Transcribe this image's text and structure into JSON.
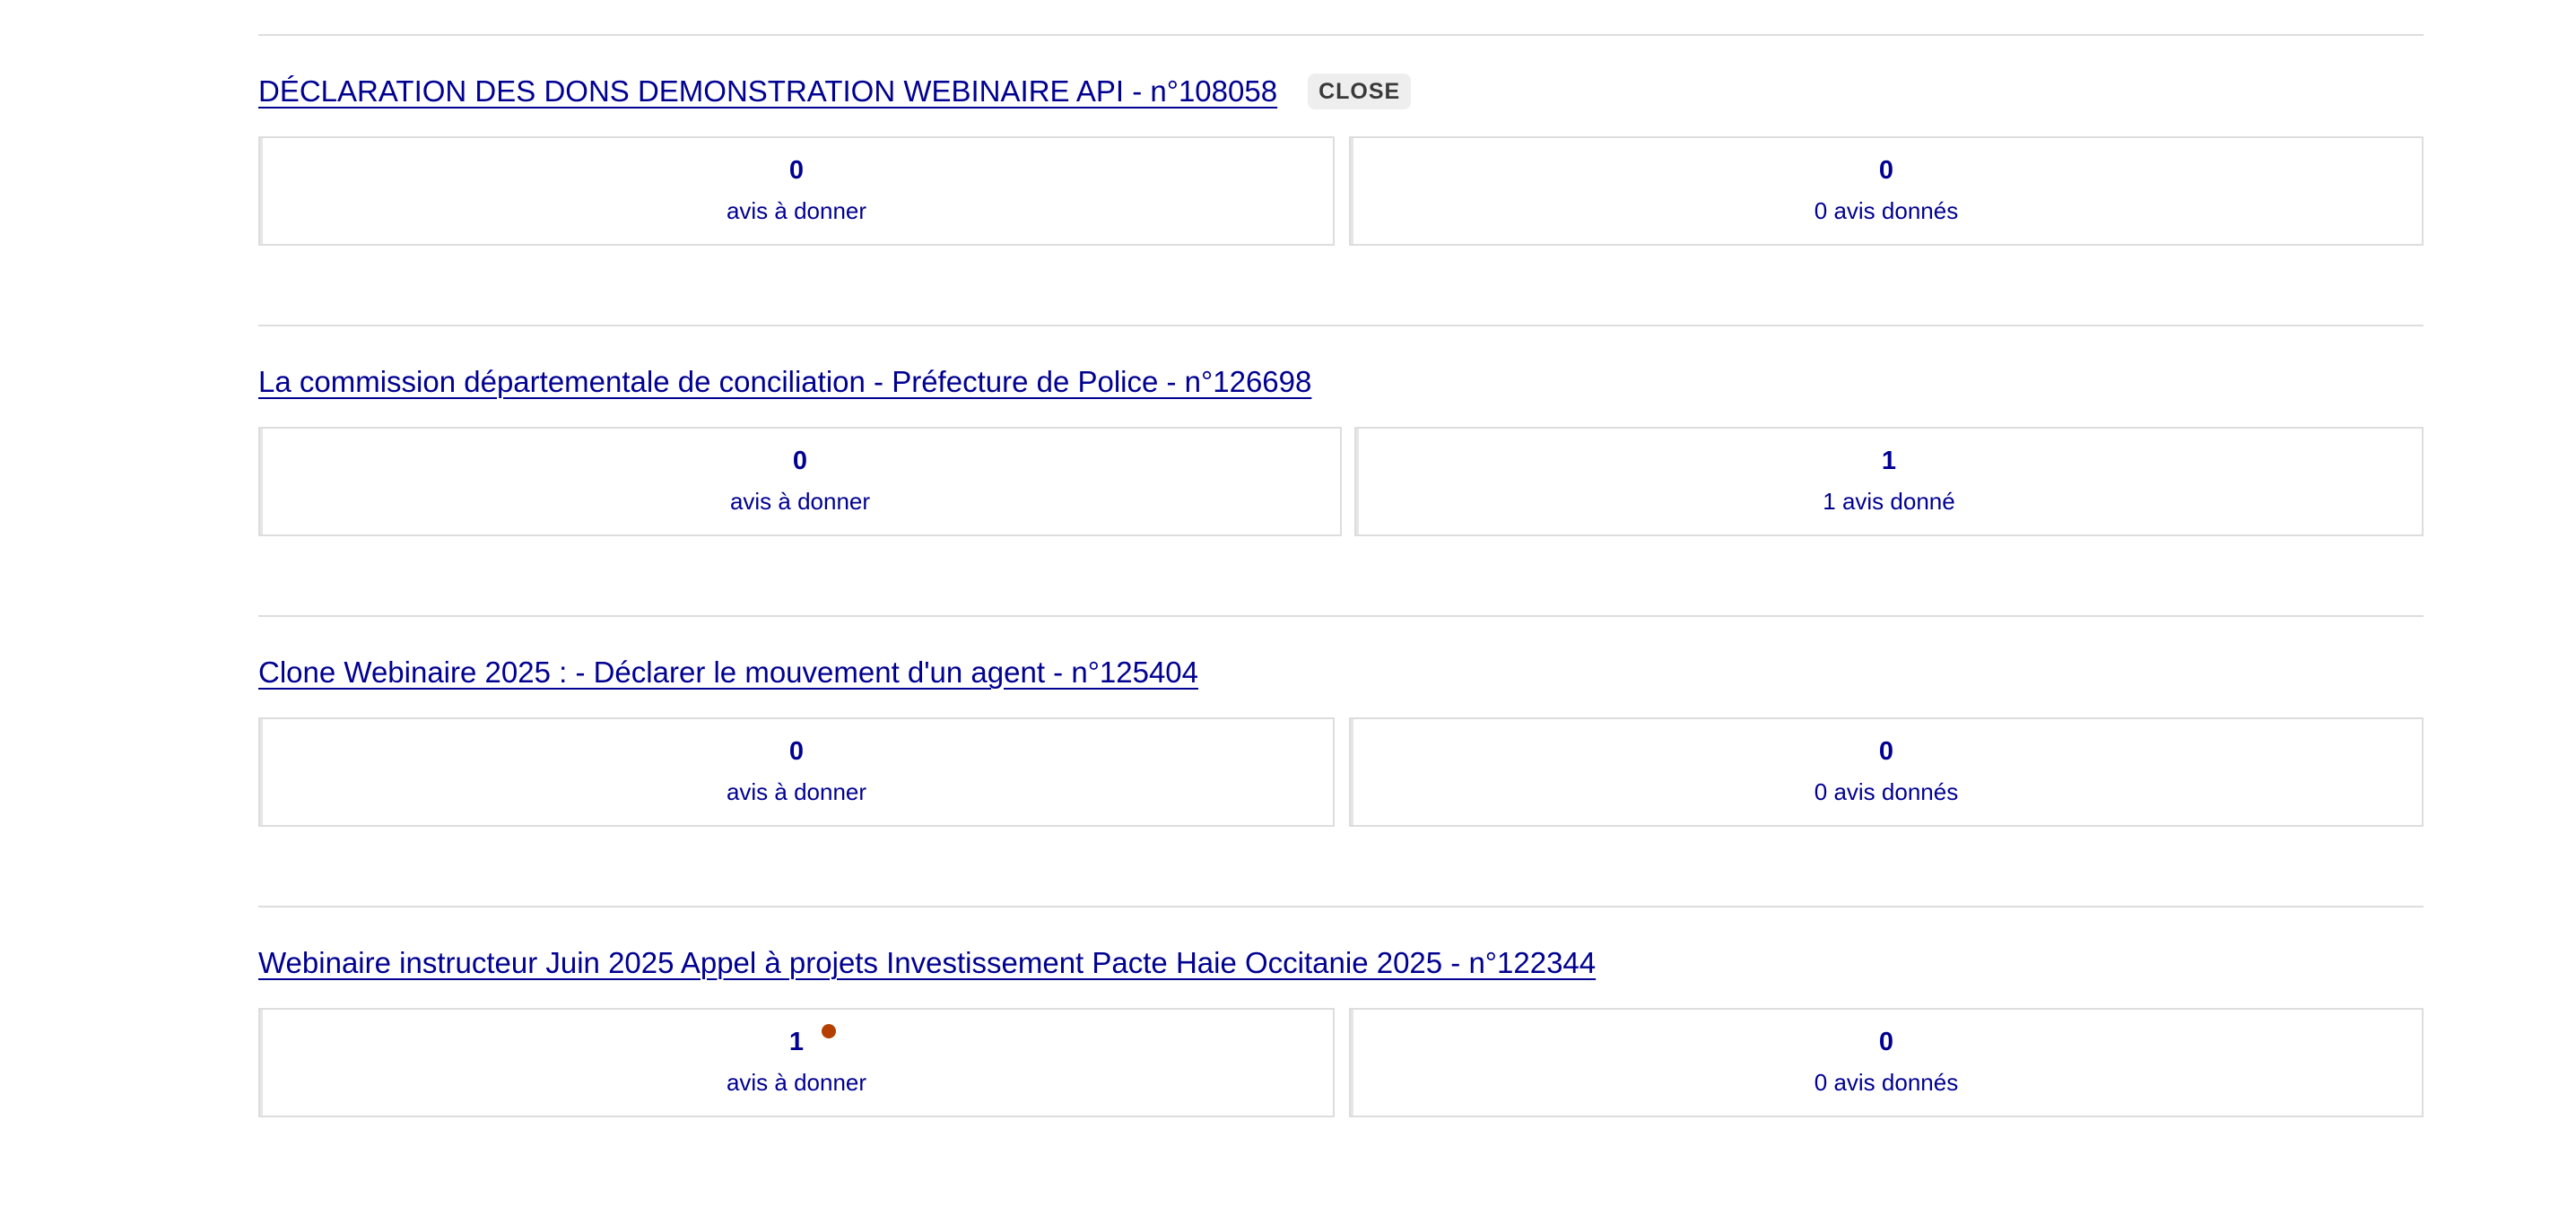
{
  "accent_color": "#000091",
  "notification_color": "#b34000",
  "procedures": [
    {
      "title": "DÉCLARATION DES DONS DEMONSTRATION WEBINAIRE API - n°108058 ",
      "badge": "CLOSE",
      "to_give": {
        "count": "0",
        "label": "avis à donner"
      },
      "given": {
        "count": "0",
        "label": "0 avis donnés"
      }
    },
    {
      "title": "La commission départementale de conciliation - Préfecture de Police - n°126698",
      "to_give": {
        "count": "0",
        "label": "avis à donner"
      },
      "given": {
        "count": "1",
        "label": "1 avis donné"
      }
    },
    {
      "title": "Clone Webinaire 2025 : - Déclarer le mouvement d'un agent - n°125404",
      "to_give": {
        "count": "0",
        "label": "avis à donner"
      },
      "given": {
        "count": "0",
        "label": "0 avis donnés"
      }
    },
    {
      "title": "Webinaire instructeur Juin 2025 Appel à projets Investissement Pacte Haie Occitanie 2025 - n°122344",
      "to_give": {
        "count": "1",
        "label": "avis à donner",
        "has_notification": true
      },
      "given": {
        "count": "0",
        "label": "0 avis donnés"
      }
    }
  ]
}
